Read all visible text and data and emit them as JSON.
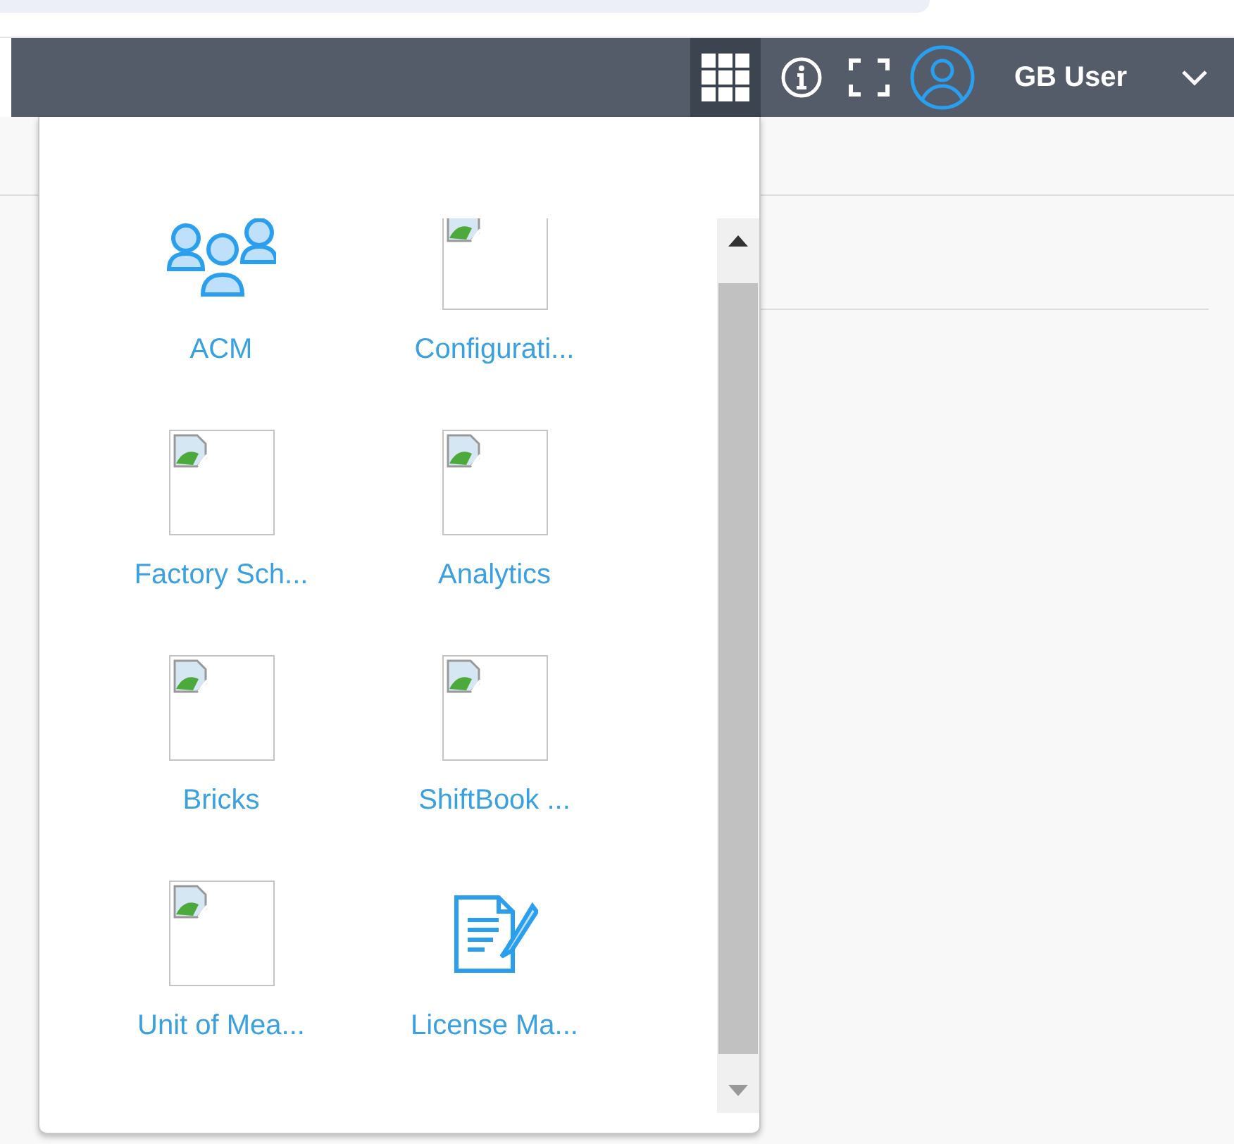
{
  "header": {
    "app_grid_button": {
      "selected": true
    },
    "user_name": "GB User"
  },
  "app_menu": {
    "items": [
      {
        "kind": "people",
        "label": "ACM"
      },
      {
        "kind": "broken-image",
        "label": "Configurati..."
      },
      {
        "kind": "broken-image",
        "label": "Factory Sch..."
      },
      {
        "kind": "broken-image",
        "label": "Analytics"
      },
      {
        "kind": "broken-image",
        "label": "Bricks"
      },
      {
        "kind": "broken-image",
        "label": "ShiftBook ..."
      },
      {
        "kind": "broken-image",
        "label": "Unit of Mea..."
      },
      {
        "kind": "document",
        "label": "License Ma..."
      }
    ]
  }
}
